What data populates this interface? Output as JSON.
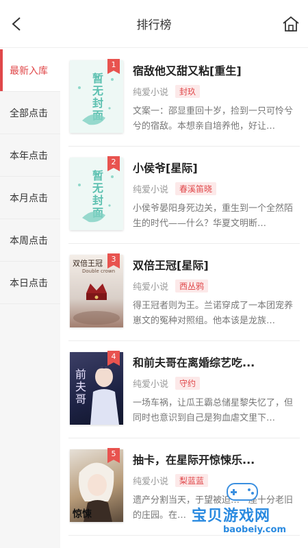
{
  "header": {
    "title": "排行榜",
    "back_icon": "chevron-left-icon",
    "home_icon": "home-icon"
  },
  "sidebar": {
    "items": [
      {
        "label": "最新入库",
        "active": true
      },
      {
        "label": "全部点击",
        "active": false
      },
      {
        "label": "本年点击",
        "active": false
      },
      {
        "label": "本月点击",
        "active": false
      },
      {
        "label": "本周点击",
        "active": false
      },
      {
        "label": "本日点击",
        "active": false
      }
    ]
  },
  "books": [
    {
      "rank": "1",
      "title": "宿敌他又甜又粘[重生]",
      "category": "纯爱小说",
      "author": "封玖",
      "desc": "文案一：邵显重回十岁，捡到一只可怜兮兮的宿敌。本想亲自培养他，好让…"
    },
    {
      "rank": "2",
      "title": "小侯爷[星际]",
      "category": "纯爱小说",
      "author": "春溪笛晓",
      "desc": "小侯爷晏阳身死边关，重生到一个全然陌生的时代——什么？华夏文明断…"
    },
    {
      "rank": "3",
      "title": "双倍王冠[星际]",
      "category": "纯爱小说",
      "author": "西丛鸦",
      "desc": "得王冠者则为王。兰诺穿成了一本团宠养崽文的冤种对照组。他本该是龙族…"
    },
    {
      "rank": "4",
      "title": "和前夫哥在离婚综艺吃...",
      "category": "纯爱小说",
      "author": "守约",
      "desc": "一场车祸，让瓜王霸总储星黎失忆了，但同时也意识到自己是狗血虐文里下…"
    },
    {
      "rank": "5",
      "title": "抽卡，在星际开惊悚乐...",
      "category": "纯爱小说",
      "author": "梨蓝蓝",
      "desc": "遗产分割当天，于望被迫…一座十分老旧的庄园。在…"
    }
  ],
  "covers": {
    "placeholder_text": "暂无封面",
    "cover3_text": "双倍王冠",
    "cover3_sub": "Double crown",
    "cover4_text": "前夫哥",
    "cover5_text": "惊悚"
  },
  "watermark": {
    "text": "宝贝游戏网",
    "sub": "baobeiy.com"
  },
  "colors": {
    "accent": "#e0484a",
    "badge": "#e8534f",
    "placeholder_teal": "#5cc0b0"
  }
}
